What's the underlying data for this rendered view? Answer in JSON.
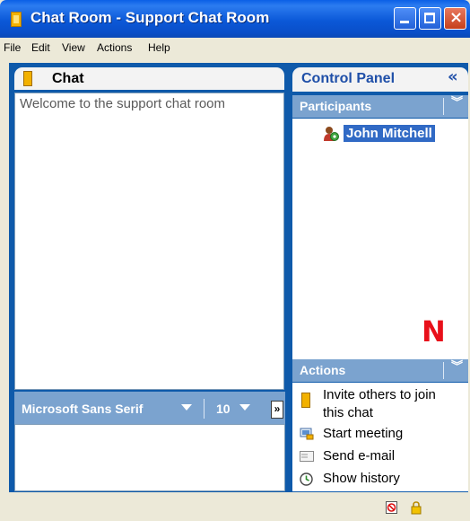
{
  "window": {
    "title": "Chat Room - Support Chat Room"
  },
  "menu": [
    "File",
    "Edit",
    "View",
    "Actions",
    "Help"
  ],
  "chat": {
    "header": "Chat",
    "messages": [
      "Welcome to the support chat room"
    ],
    "font_name": "Microsoft Sans Serif",
    "font_size": "10",
    "expand_label": "»"
  },
  "control_panel": {
    "title": "Control Panel",
    "collapse_glyph": "«",
    "participants_label": "Participants",
    "participants": [
      "John Mitchell"
    ],
    "actions_label": "Actions",
    "actions": [
      "Invite others to join",
      "this chat",
      "Start meeting",
      "Send e-mail",
      "Show history"
    ],
    "logo": "N"
  },
  "colors": {
    "accent": "#0F5AAA",
    "section": "#7BA3CF",
    "selection": "#316AC5",
    "logo": "#E8101A"
  }
}
